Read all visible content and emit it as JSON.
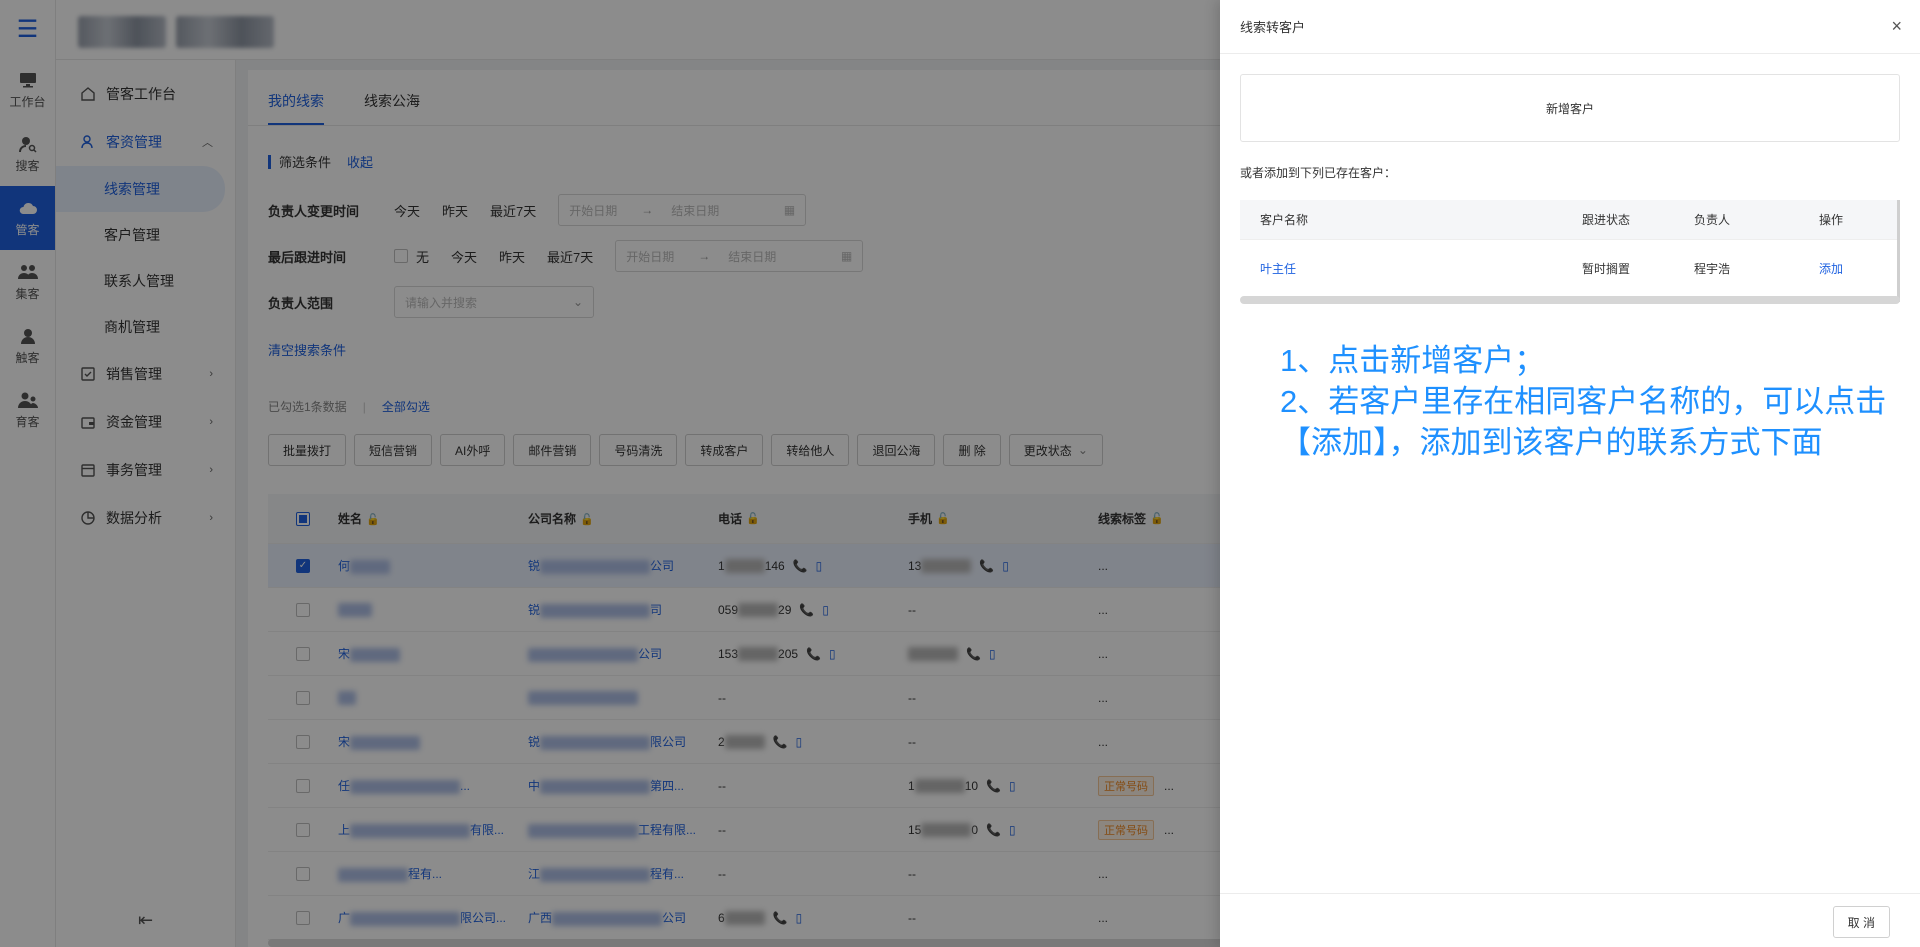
{
  "rail": {
    "items": [
      {
        "label": "工作台",
        "icon": "monitor-icon"
      },
      {
        "label": "搜客",
        "icon": "search-user-icon"
      },
      {
        "label": "管客",
        "icon": "cloud-icon"
      },
      {
        "label": "集客",
        "icon": "group-icon"
      },
      {
        "label": "触客",
        "icon": "contact-icon"
      },
      {
        "label": "育客",
        "icon": "nurture-icon"
      }
    ],
    "active_index": 2
  },
  "sidebar": {
    "workbench": "管客工作台",
    "customer_mgmt": "客资管理",
    "subs": [
      "线索管理",
      "客户管理",
      "联系人管理",
      "商机管理"
    ],
    "sales": "销售管理",
    "funds": "资金管理",
    "affairs": "事务管理",
    "analytics": "数据分析"
  },
  "main": {
    "tabs": [
      "我的线索",
      "线索公海"
    ],
    "filter_title": "筛选条件",
    "collapse": "收起",
    "f1_label": "负责人变更时间",
    "f2_label": "最后跟进时间",
    "f3_label": "负责人范围",
    "opt_today": "今天",
    "opt_yesterday": "昨天",
    "opt_7days": "近7天",
    "opt_recent7": "最近7天",
    "opt_none": "无",
    "start_date": "开始日期",
    "end_date": "结束日期",
    "arrow": "→",
    "owner_placeholder": "请输入并搜索",
    "clear": "清空搜索条件",
    "selected_info": "已勾选1条数据",
    "select_all": "全部勾选",
    "toolbar": [
      "批量拨打",
      "短信营销",
      "AI外呼",
      "邮件营销",
      "号码清洗",
      "转成客户",
      "转给他人",
      "退回公海",
      "删 除",
      "更改状态"
    ],
    "columns": [
      "姓名",
      "公司名称",
      "电话",
      "手机",
      "线索标签"
    ],
    "rows": [
      {
        "name": "何",
        "company": "锐",
        "company_tail": "公司",
        "tel_a": "1",
        "tel_b": "146",
        "mob": "13",
        "tag": "...",
        "selected": true
      },
      {
        "name": "",
        "company": "锐",
        "company_tail": "司",
        "tel_a": "059",
        "tel_b": "29",
        "mob": "--",
        "tag": "...",
        "selected": false
      },
      {
        "name": "宋",
        "company": "",
        "company_tail": "公司",
        "tel_a": "153",
        "tel_b": "205",
        "mob": "",
        "tag": "...",
        "selected": false
      },
      {
        "name": "",
        "company": "",
        "company_tail": "",
        "tel_a": "--",
        "tel_b": "",
        "mob": "--",
        "tag": "...",
        "selected": false
      },
      {
        "name": "宋",
        "company": "锐",
        "company_tail": "限公司",
        "tel_a": "2",
        "tel_b": "",
        "mob": "--",
        "tag": "...",
        "selected": false
      },
      {
        "name": "任",
        "company": "中",
        "company_tail": "第四...",
        "tel_a": "--",
        "tel_b": "",
        "mob": "1",
        "mob_b": "10",
        "tag": "正常号码",
        "selected": false
      },
      {
        "name": "上",
        "company": "",
        "company_tail": "工程有限...",
        "tel_a": "--",
        "tel_b": "",
        "mob": "15",
        "mob_b": "0",
        "tag": "正常号码",
        "selected": false
      },
      {
        "name": "",
        "company": "江",
        "company_tail": "程有...",
        "tel_a": "--",
        "tel_b": "",
        "mob": "--",
        "tag": "...",
        "selected": false
      },
      {
        "name": "广",
        "company": "广西",
        "company_tail": "公司",
        "tel_a": "6",
        "tel_b": "",
        "mob": "--",
        "tag": "...",
        "selected": false
      }
    ],
    "name_tails": [
      "",
      "",
      "",
      "",
      "",
      "...",
      "有限...",
      "程有...",
      "限公司..."
    ],
    "ellipsis": "..."
  },
  "drawer": {
    "title": "线索转客户",
    "close": "×",
    "new_customer": "新增客户",
    "exist_tip": "或者添加到下列已存在客户：",
    "columns": [
      "客户名称",
      "跟进状态",
      "负责人",
      "操作"
    ],
    "row": {
      "name": "叶主任",
      "status": "暂时搁置",
      "owner": "程宇浩",
      "action": "添加"
    },
    "annotation_line1": "1、点击新增客户；",
    "annotation_line2": "2、若客户里存在相同客户名称的，可以点击【添加】，添加到该客户的联系方式下面",
    "cancel": "取 消"
  },
  "colors": {
    "primary": "#1f62e0",
    "annotation": "#1e90ff",
    "tag_orange": "#f08a24"
  }
}
